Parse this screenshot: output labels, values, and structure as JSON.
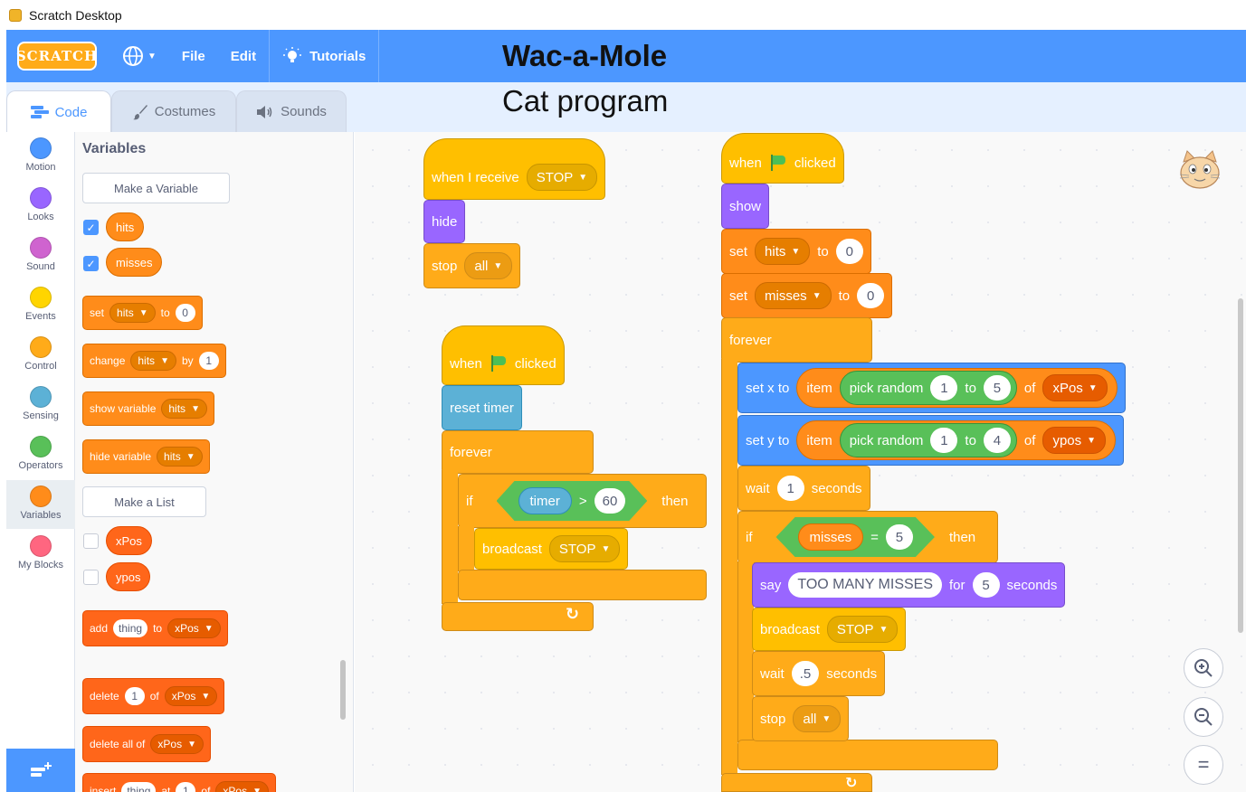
{
  "window": {
    "title": "Scratch Desktop"
  },
  "menubar": {
    "logo": "SCRATCH",
    "file": "File",
    "edit": "Edit",
    "tutorials": "Tutorials",
    "title_overlay": "Wac-a-Mole"
  },
  "subbar": {
    "subtitle_overlay": "Cat program"
  },
  "tabs": {
    "code": "Code",
    "costumes": "Costumes",
    "sounds": "Sounds"
  },
  "categories": [
    {
      "label": "Motion",
      "color": "#4c97ff"
    },
    {
      "label": "Looks",
      "color": "#9966ff"
    },
    {
      "label": "Sound",
      "color": "#cf63cf"
    },
    {
      "label": "Events",
      "color": "#ffd500"
    },
    {
      "label": "Control",
      "color": "#ffab19"
    },
    {
      "label": "Sensing",
      "color": "#5cb1d6"
    },
    {
      "label": "Operators",
      "color": "#59c059"
    },
    {
      "label": "Variables",
      "color": "#ff8c1a"
    },
    {
      "label": "My Blocks",
      "color": "#ff6680"
    }
  ],
  "palette": {
    "heading": "Variables",
    "make_variable": "Make a Variable",
    "vars": [
      "hits",
      "misses"
    ],
    "set_block": {
      "label": "set",
      "var": "hits",
      "to": "to",
      "value": "0"
    },
    "change_block": {
      "label": "change",
      "var": "hits",
      "by": "by",
      "value": "1"
    },
    "show_block": {
      "label": "show variable",
      "var": "hits"
    },
    "hide_block": {
      "label": "hide variable",
      "var": "hits"
    },
    "make_list": "Make a List",
    "lists": [
      "xPos",
      "ypos"
    ],
    "add_block": {
      "label": "add",
      "item": "thing",
      "to": "to",
      "list": "xPos"
    },
    "delete_block": {
      "label": "delete",
      "index": "1",
      "of": "of",
      "list": "xPos"
    },
    "delete_all_block": {
      "label": "delete all of",
      "list": "xPos"
    },
    "insert_block": {
      "label": "insert",
      "item": "thing",
      "at": "at",
      "index": "1",
      "of": "of",
      "list": "xPos"
    }
  },
  "script1": {
    "hat": {
      "label": "when I receive",
      "message": "STOP"
    },
    "hide": "hide",
    "stop": {
      "label": "stop",
      "option": "all"
    }
  },
  "script2": {
    "hat": {
      "when": "when",
      "clicked": "clicked"
    },
    "reset": "reset timer",
    "forever": "forever",
    "if": {
      "if": "if",
      "timer": "timer",
      "op": ">",
      "value": "60",
      "then": "then"
    },
    "broadcast": {
      "label": "broadcast",
      "message": "STOP"
    }
  },
  "script3": {
    "hat": {
      "when": "when",
      "clicked": "clicked"
    },
    "show": "show",
    "set_hits": {
      "label": "set",
      "var": "hits",
      "to": "to",
      "value": "0"
    },
    "set_misses": {
      "label": "set",
      "var": "misses",
      "to": "to",
      "value": "0"
    },
    "forever": "forever",
    "setx": {
      "label": "set x to",
      "item": "item",
      "pick": "pick random",
      "from": "1",
      "to": "to",
      "upto": "5",
      "of": "of",
      "list": "xPos"
    },
    "sety": {
      "label": "set y to",
      "item": "item",
      "pick": "pick random",
      "from": "1",
      "to": "to",
      "upto": "4",
      "of": "of",
      "list": "ypos"
    },
    "wait1": {
      "label": "wait",
      "value": "1",
      "seconds": "seconds"
    },
    "if": {
      "if": "if",
      "var": "misses",
      "op": "=",
      "value": "5",
      "then": "then"
    },
    "say": {
      "label": "say",
      "text": "TOO MANY MISSES",
      "for": "for",
      "value": "5",
      "seconds": "seconds"
    },
    "broadcast": {
      "label": "broadcast",
      "message": "STOP"
    },
    "wait2": {
      "label": "wait",
      "value": ".5",
      "seconds": "seconds"
    },
    "stop": {
      "label": "stop",
      "option": "all"
    }
  }
}
